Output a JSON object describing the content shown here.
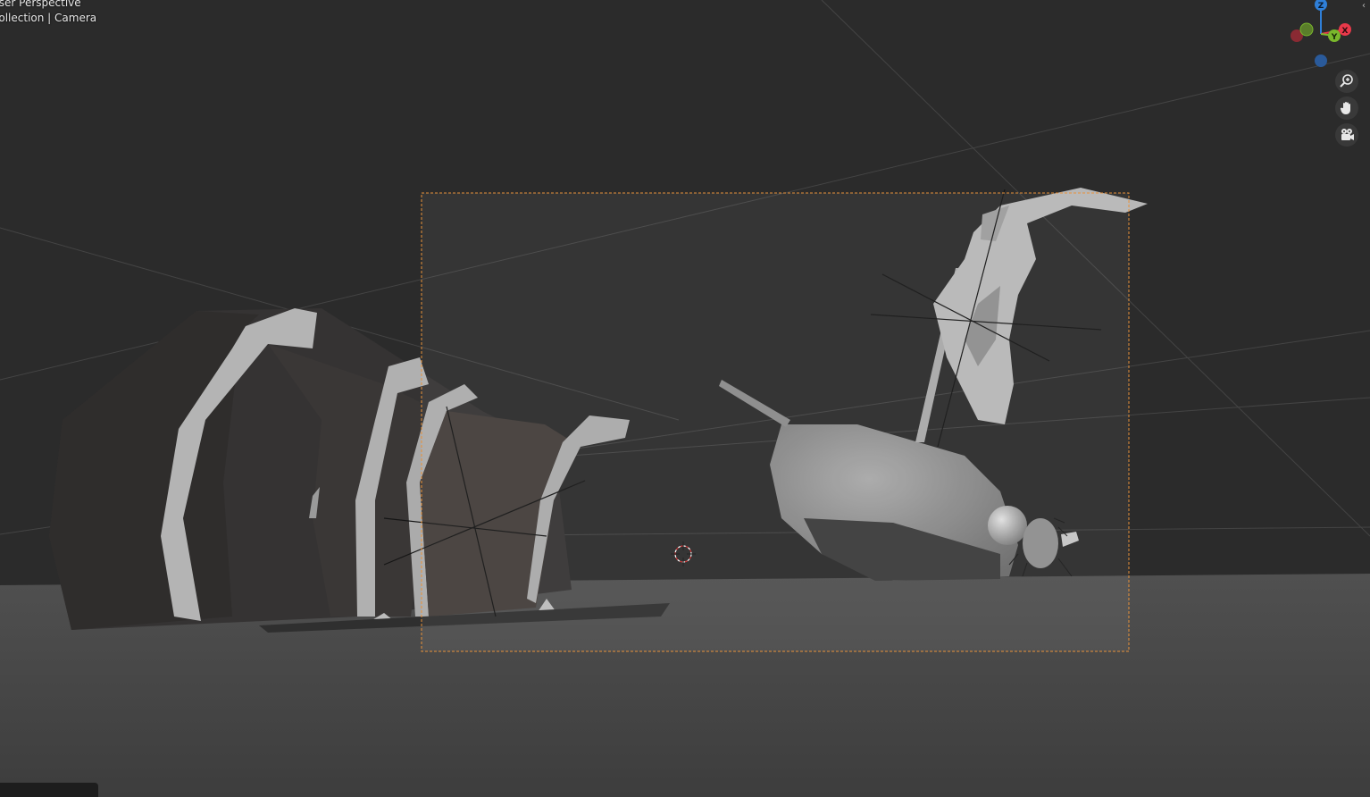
{
  "viewport": {
    "view_label": "User Perspective",
    "collection_label": "Collection | Camera"
  },
  "gizmo": {
    "axes": [
      {
        "label": "Z",
        "color": "#2f7fd8"
      },
      {
        "label": "X",
        "color": "#e8394a"
      },
      {
        "label": "Y",
        "color": "#7ab82c"
      }
    ]
  },
  "navigation": {
    "zoom_icon": "zoom-icon",
    "pan_icon": "hand-icon",
    "camera_icon": "camera-icon"
  },
  "colors": {
    "background": "#2b2b2b",
    "floor": "#4a4a4a",
    "camera_frame": "#e8923a",
    "cursor": "#d23a3a"
  }
}
